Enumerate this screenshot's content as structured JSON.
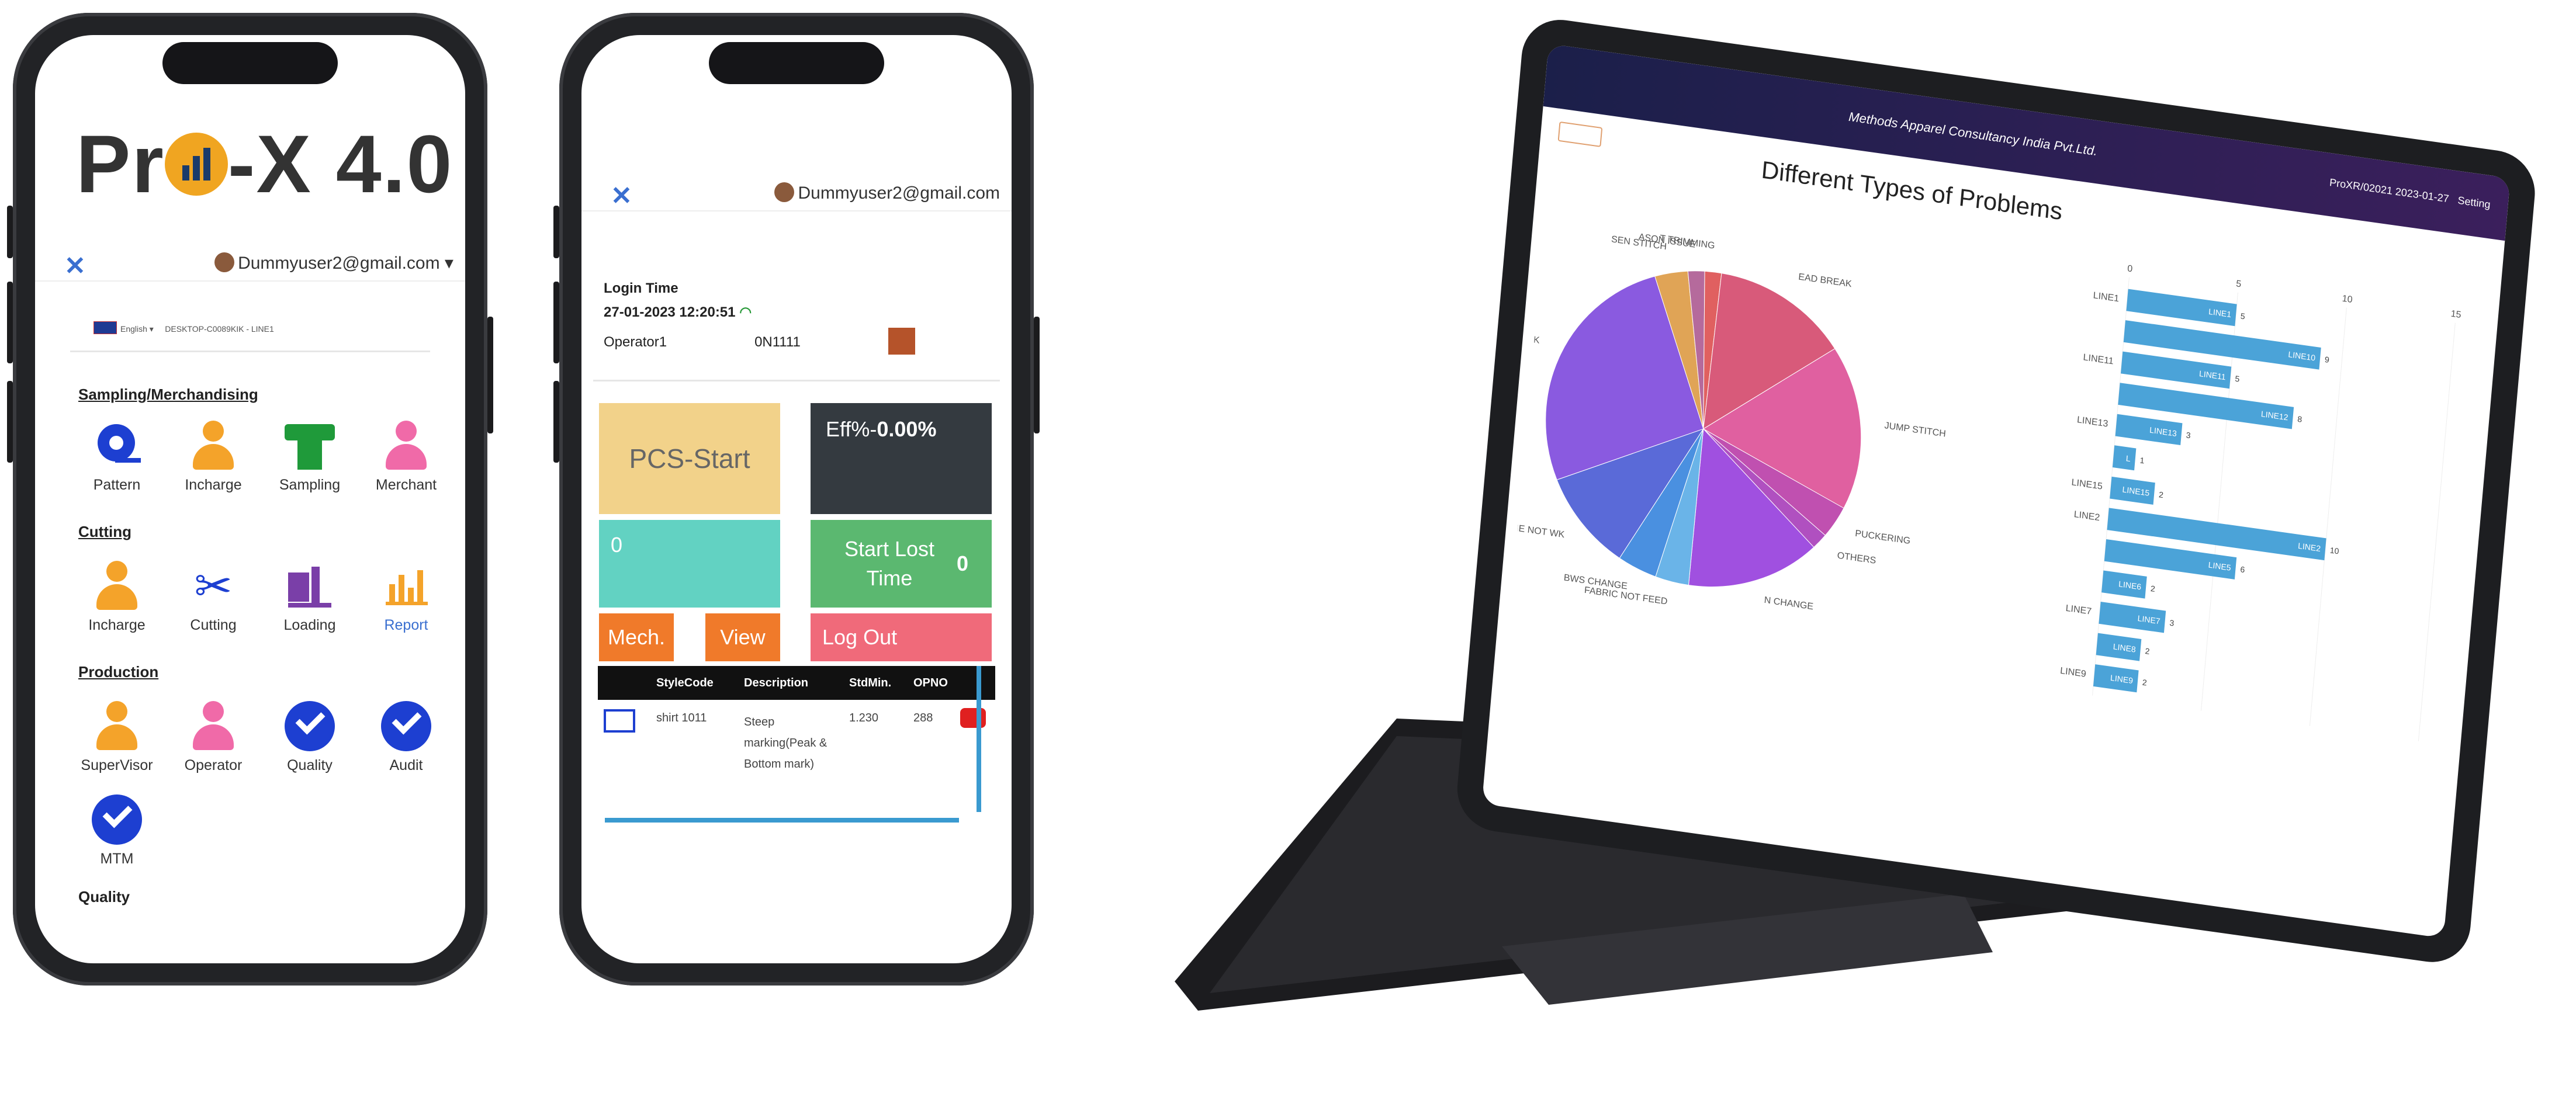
{
  "phone_menu": {
    "logo_text_a": "Pr",
    "logo_text_b": "-X 4.0",
    "user_email": "Dummyuser2@gmail.com",
    "language": "English",
    "device_text": "DESKTOP-C0089KIK - LINE1",
    "sections": [
      {
        "title": "Sampling/Merchandising",
        "tiles": [
          "Pattern",
          "Incharge",
          "Sampling",
          "Merchant"
        ]
      },
      {
        "title": "Cutting",
        "tiles": [
          "Incharge",
          "Cutting",
          "Loading",
          "Report"
        ]
      },
      {
        "title": "Production",
        "tiles": [
          "SuperVisor",
          "Operator",
          "Quality",
          "Audit",
          "MTM"
        ]
      },
      {
        "title": "Quality",
        "tiles": []
      }
    ],
    "colors": {
      "orange": "#f4a32a",
      "pink": "#f06aa8",
      "green": "#1f9a3a",
      "blue": "#1d3fd1",
      "purple": "#7a3fa8"
    }
  },
  "phone_operator": {
    "user_email": "Dummyuser2@gmail.com",
    "login_label": "Login Time",
    "login_time": "27-01-2023 12:20:51",
    "operator": "Operator1",
    "operator_code": "0N1111",
    "buttons": {
      "pcs_start": "PCS-Start",
      "eff_label": "Eff%-",
      "eff_value": "0.00%",
      "count": "0",
      "start_lost_time": "Start Lost Time",
      "lost_count": "0",
      "mech": "Mech.",
      "view": "View",
      "logout": "Log Out"
    },
    "table": {
      "headers": [
        "StyleCode",
        "Description",
        "StdMin.",
        "OPNO"
      ],
      "rows": [
        [
          "shirt 1011",
          "Steep marking(Peak & Bottom mark)",
          "1.230",
          "288"
        ]
      ]
    }
  },
  "tablet": {
    "header_title": "Methods Apparel Consultancy India Pvt.Ltd.",
    "header_right": "ProXR/02021 2023-01-27",
    "header_setting": "Setting",
    "chart_data": {
      "type": "pie",
      "title": "Different Types of Problems",
      "labels": [
        "SEN STITCH",
        "ASON ISSUE",
        "T TRIMMING",
        "EAD BREAK",
        "JUMP STITCH",
        "PUCKERING",
        "OTHERS",
        "N CHANGE",
        "FABRIC NOT FEED",
        "BWS CHANGE",
        "MACHINE NOT WK",
        "NEEDLE BREAK"
      ],
      "values": [
        3.4,
        1.7,
        1.7,
        13.8,
        16.8,
        3.4,
        1.7,
        13.8,
        3.4,
        4,
        10,
        26
      ],
      "colors": [
        "#e0a456",
        "#b56a9c",
        "#e06060",
        "#d85a7a",
        "#e060a0",
        "#c050b0",
        "#b050c0",
        "#a050e0",
        "#6ab4e8",
        "#4a90e0",
        "#5a6ad8",
        "#8a5ae0"
      ]
    },
    "bar_chart": {
      "type": "bar",
      "axis_ticks": [
        "0",
        "5",
        "10",
        "15"
      ],
      "xlim": [
        0,
        15
      ],
      "rows": [
        {
          "label": "LINE1",
          "name": "LINE1",
          "value": 5
        },
        {
          "label": "",
          "name": "LINE10",
          "value": 9
        },
        {
          "label": "LINE11",
          "name": "LINE11",
          "value": 5
        },
        {
          "label": "",
          "name": "LINE12",
          "value": 8
        },
        {
          "label": "LINE13",
          "name": "LINE13",
          "value": 3
        },
        {
          "label": "",
          "name": "L",
          "value": 1
        },
        {
          "label": "LINE15",
          "name": "LINE15",
          "value": 2
        },
        {
          "label": "LINE2",
          "name": "LINE2",
          "value": 10
        },
        {
          "label": "",
          "name": "LINE5",
          "value": 6
        },
        {
          "label": "",
          "name": "LINE6",
          "value": 2
        },
        {
          "label": "LINE7",
          "name": "LINE7",
          "value": 3
        },
        {
          "label": "",
          "name": "LINE8",
          "value": 2
        },
        {
          "label": "LINE9",
          "name": "LINE9",
          "value": 2
        }
      ]
    }
  }
}
